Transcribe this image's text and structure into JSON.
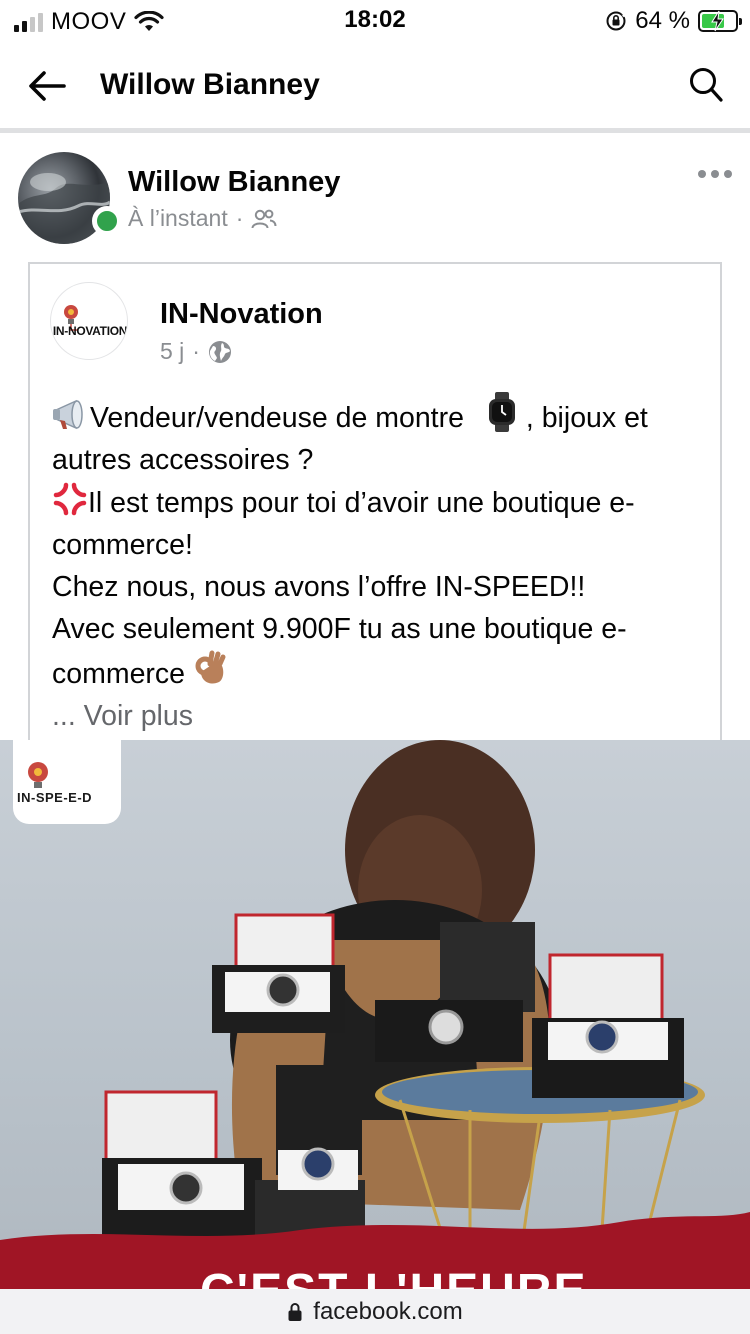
{
  "status_bar": {
    "carrier": "MOOV",
    "time": "18:02",
    "battery_percent": "64 %",
    "battery_level": 0.64,
    "signal_bars": 2
  },
  "header": {
    "title": "Willow Bianney",
    "back_icon": "back-arrow-icon",
    "search_icon": "search-icon"
  },
  "post": {
    "author": "Willow Bianney",
    "timestamp": "À l’instant",
    "separator": "·",
    "audience_icon": "friends-icon",
    "online": true
  },
  "shared": {
    "page_name": "IN-Novation",
    "logo_text": "IN-NOVATION",
    "age": "5 j",
    "separator": "·",
    "audience_icon": "globe-icon",
    "lines": [
      "Vendeur/vendeuse de montre",
      ", bijoux et",
      "autres accessoires ?",
      "Il est temps pour toi d’avoir une boutique e-",
      "commerce!",
      "Chez nous, nous avons l’offre IN-SPEED!!",
      "Avec seulement 9.900F tu as une boutique e-",
      "commerce"
    ],
    "voir_plus": "... Voir plus"
  },
  "image": {
    "badge_text": "IN-SPE-E-D",
    "banner_text": "C'EST L'HEURE"
  },
  "url_bar": {
    "domain": "facebook.com"
  },
  "colors": {
    "online_green": "#31a24c",
    "meta_gray": "#8a8d91",
    "banner_red": "#a01525"
  }
}
